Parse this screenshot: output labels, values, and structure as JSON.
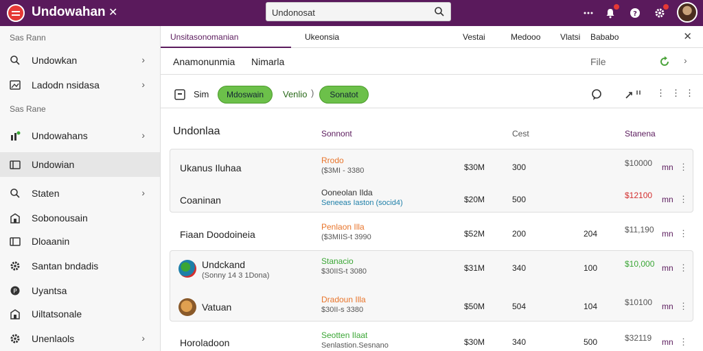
{
  "app": {
    "title": "Undowahan"
  },
  "search": {
    "value": "Undonosat"
  },
  "sidebar": {
    "section1": "Sas Rann",
    "section2": "Sas Rane",
    "items": [
      {
        "label": "Undowkan",
        "icon": "search-icon",
        "chevron": true
      },
      {
        "label": "Ladodn nsidasa",
        "icon": "image-icon",
        "chevron": true
      },
      {
        "label": "Undowahans",
        "icon": "chart-icon",
        "chevron": true
      },
      {
        "label": "Undowian",
        "icon": "folder-icon",
        "chevron": false
      },
      {
        "label": "Staten",
        "icon": "search-icon",
        "chevron": true
      },
      {
        "label": "Sobonousain",
        "icon": "building-icon",
        "chevron": false
      },
      {
        "label": "Dloaanin",
        "icon": "folder-icon",
        "chevron": false
      },
      {
        "label": "Santan bndadis",
        "icon": "gear-icon",
        "chevron": false
      },
      {
        "label": "Uyantsa",
        "icon": "circle-icon",
        "chevron": false
      },
      {
        "label": "Uiltatsonale",
        "icon": "building-icon",
        "chevron": false
      },
      {
        "label": "Unenlaols",
        "icon": "gear-icon",
        "chevron": true
      }
    ]
  },
  "tabs": [
    "Unsitasonomanian",
    "Ukeonsia",
    "Vestai",
    "Medooo",
    "Vlatsi",
    "Bababo"
  ],
  "subbar": {
    "left": "Anamonunmia",
    "middle": "Nimarla",
    "right": "File"
  },
  "toolbar": {
    "label": "Sim",
    "chips": [
      "Mdoswain",
      "Sonatot"
    ],
    "text": "Venlio"
  },
  "headers": {
    "name": "Undonlaa",
    "col2": "Sonnont",
    "col3": "Cest",
    "col4": "Stanena"
  },
  "rows": [
    {
      "name": "Ukanus Iluhaa",
      "s1": "Rrodo",
      "s2": "($3MI - 3380",
      "v1": "$30M",
      "v2": "300",
      "v3": "",
      "price": "$10000",
      "unit": "mn",
      "thumb": ""
    },
    {
      "name": "Coaninan",
      "s1": "Ooneolan Ilda",
      "s2": "Seneeas Iaston (socid4)",
      "v1": "$20M",
      "v2": "500",
      "v3": "",
      "price": "$12100",
      "unit": "mn",
      "thumb": ""
    },
    {
      "name": "Fiaan Doodoineia",
      "s1": "Penlaon Illa",
      "s2": "($3MIIS-t 3990",
      "v1": "$52M",
      "v2": "200",
      "v3": "204",
      "price": "$11,190",
      "unit": "mn",
      "thumb": ""
    },
    {
      "name": "Undckand",
      "sub": "(Sonny 14 3 1Dona)",
      "s1": "Stanacio",
      "s2": "$30IIS-t 3080",
      "v1": "$31M",
      "v2": "340",
      "v3": "100",
      "price": "$10,000",
      "unit": "mn",
      "thumb": "globe"
    },
    {
      "name": "Vatuan",
      "s1": "Dradoun Illa",
      "s2": "$30II-s 3380",
      "v1": "$50M",
      "v2": "504",
      "v3": "104",
      "price": "$10100",
      "unit": "mn",
      "thumb": "food"
    },
    {
      "name": "Horoladoon",
      "s1": "Seotten Ilaat",
      "s2": "Senlastion.Sesnano",
      "v1": "$30M",
      "v2": "340",
      "v3": "500",
      "price": "$32119",
      "unit": "mn",
      "thumb": ""
    }
  ],
  "colors": {
    "primary": "#5a1a5c",
    "green": "#6cc04a",
    "red": "#d32f2f",
    "orange": "#e8742a",
    "teal": "#1e7fa8"
  }
}
